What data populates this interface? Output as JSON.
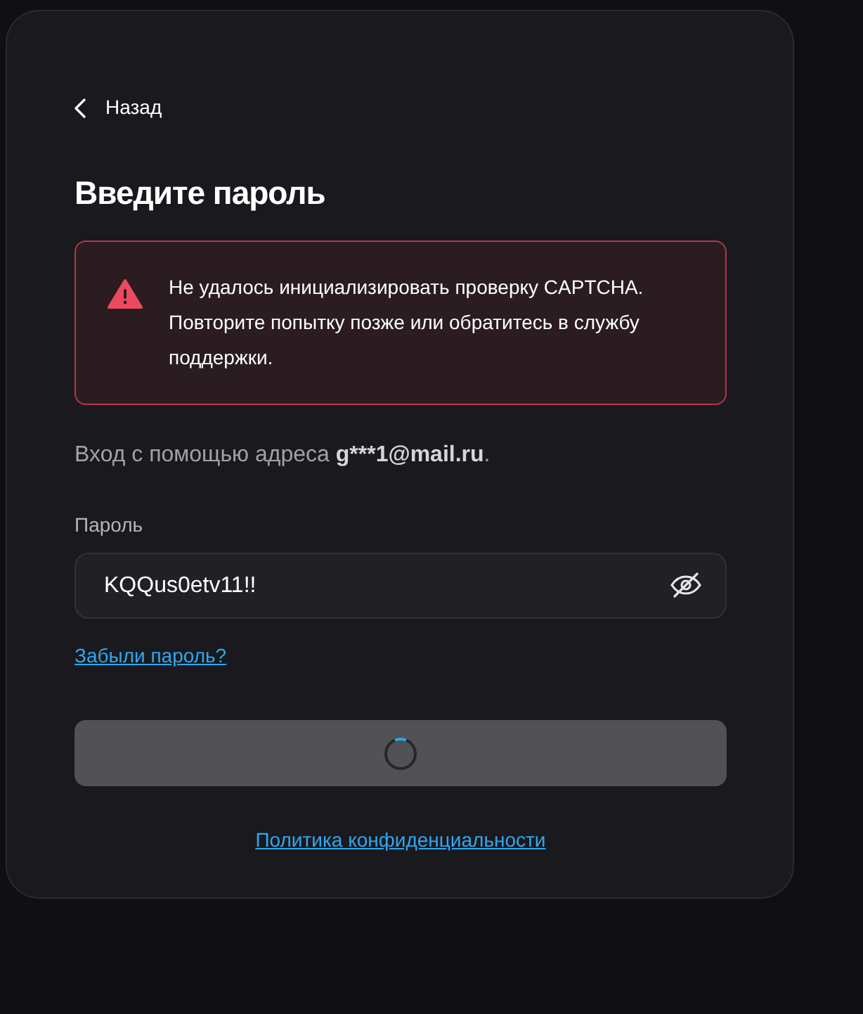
{
  "back_link": {
    "label": "Назад"
  },
  "title": "Введите пароль",
  "alert": {
    "kind": "error",
    "message": "Не удалось инициализировать проверку CAPTCHA. Повторите попытку позже или обратитесь в службу поддержки."
  },
  "login_hint": {
    "text": "Вход с помощью адреса ",
    "email": "g***1@mail.ru",
    "end": "."
  },
  "password_field": {
    "label": "Пароль",
    "value": "KQQus0etv11!!",
    "visible": true
  },
  "forgot_link": "Забыли пароль?",
  "submit_button": {
    "loading": true
  },
  "privacy_link": "Политика конфиденциальности"
}
